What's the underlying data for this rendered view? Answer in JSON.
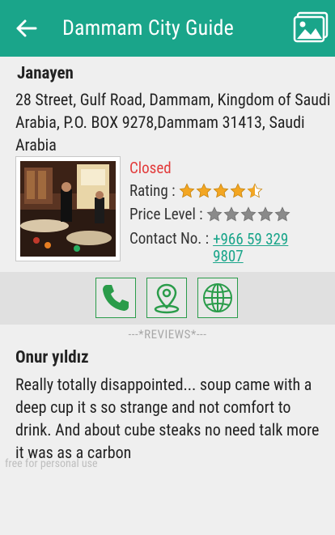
{
  "appbar": {
    "title": "Dammam City Guide",
    "back_icon": "arrow-left-icon",
    "gallery_icon": "image-gallery-icon",
    "color": "#1aa58a"
  },
  "place": {
    "name": "Janayen",
    "address": "28 Street, Gulf Road, Dammam, Kingdom of Saudi Arabia, P.O. BOX 9278,Dammam 31413, Saudi Arabia",
    "status": "Closed",
    "rating_label": "Rating :",
    "rating_value": 4.5,
    "price_label": "Price Level :",
    "price_level": 0,
    "contact_label": "Contact No. :",
    "contact_number": "+966 59 329 9807"
  },
  "actions": [
    {
      "icon": "phone-icon"
    },
    {
      "icon": "map-pin-icon"
    },
    {
      "icon": "globe-icon"
    }
  ],
  "reviews": {
    "separator": "---*REVIEWS*---",
    "items": [
      {
        "author": "Onur yıldız",
        "text": "Really totally disappointed... soup came with a deep cup it s so strange and not comfort to drink. And about cube steaks no need talk more it was as a carbon"
      }
    ]
  },
  "watermark": "free for personal use"
}
